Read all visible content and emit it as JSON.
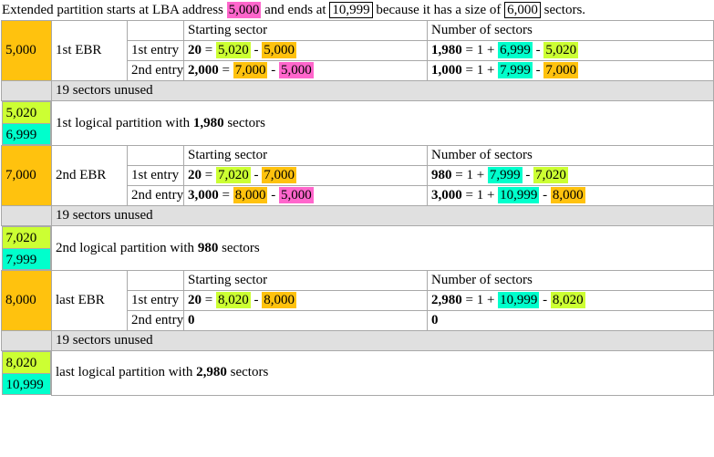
{
  "colors": {
    "orange": "#ffc20e",
    "green": "#ccff33",
    "cyan": "#00ffcc",
    "magenta": "#ff66cc",
    "gray": "#e0e0e0",
    "border": "#a9a9a9"
  },
  "caption": {
    "part1": "Extended partition starts at LBA address",
    "start_lba": "5,000",
    "part2": "and ends at",
    "end_lba": "10,999",
    "part3": "because it has a size of",
    "size": "6,000",
    "part4": "sectors."
  },
  "headers": {
    "starting_sector": "Starting sector",
    "number_of_sectors": "Number of sectors",
    "entry1": "1st entry",
    "entry2": "2nd entry"
  },
  "unused_text": "19 sectors unused",
  "blocks": [
    {
      "lba": "5,000",
      "ebr": "1st EBR",
      "entry1": {
        "start": {
          "result": "20",
          "op1": "5,020",
          "op2": "5,000",
          "op1_color": "green",
          "op2_color": "orange"
        },
        "num": {
          "result": "1,980",
          "op1": "6,999",
          "op2": "5,020",
          "op1_color": "cyan",
          "op2_color": "green"
        }
      },
      "entry2": {
        "start": {
          "result": "2,000",
          "op1": "7,000",
          "op2": "5,000",
          "op1_color": "orange",
          "op2_color": "magenta"
        },
        "num": {
          "result": "1,000",
          "op1": "7,999",
          "op2": "7,000",
          "op1_color": "cyan",
          "op2_color": "orange"
        }
      },
      "partition": {
        "top": "5,020",
        "bottom": "6,999",
        "pre": "1st logical partition with",
        "count": "1,980",
        "post": "sectors"
      }
    },
    {
      "lba": "7,000",
      "ebr": "2nd EBR",
      "entry1": {
        "start": {
          "result": "20",
          "op1": "7,020",
          "op2": "7,000",
          "op1_color": "green",
          "op2_color": "orange"
        },
        "num": {
          "result": "980",
          "op1": "7,999",
          "op2": "7,020",
          "op1_color": "cyan",
          "op2_color": "green"
        }
      },
      "entry2": {
        "start": {
          "result": "3,000",
          "op1": "8,000",
          "op2": "5,000",
          "op1_color": "orange",
          "op2_color": "magenta"
        },
        "num": {
          "result": "3,000",
          "op1": "10,999",
          "op2": "8,000",
          "op1_color": "cyan",
          "op2_color": "orange"
        }
      },
      "partition": {
        "top": "7,020",
        "bottom": "7,999",
        "pre": "2nd logical partition with",
        "count": "980",
        "post": "sectors"
      }
    },
    {
      "lba": "8,000",
      "ebr": "last EBR",
      "entry1": {
        "start": {
          "result": "20",
          "op1": "8,020",
          "op2": "8,000",
          "op1_color": "green",
          "op2_color": "orange"
        },
        "num": {
          "result": "2,980",
          "op1": "10,999",
          "op2": "8,020",
          "op1_color": "cyan",
          "op2_color": "green"
        }
      },
      "entry2": {
        "start": {
          "result": "0",
          "op1": "",
          "op2": "",
          "op1_color": "",
          "op2_color": ""
        },
        "num": {
          "result": "0",
          "op1": "",
          "op2": "",
          "op1_color": "",
          "op2_color": ""
        }
      },
      "partition": {
        "top": "8,020",
        "bottom": "10,999",
        "pre": "last logical partition with",
        "count": "2,980",
        "post": "sectors"
      }
    }
  ]
}
